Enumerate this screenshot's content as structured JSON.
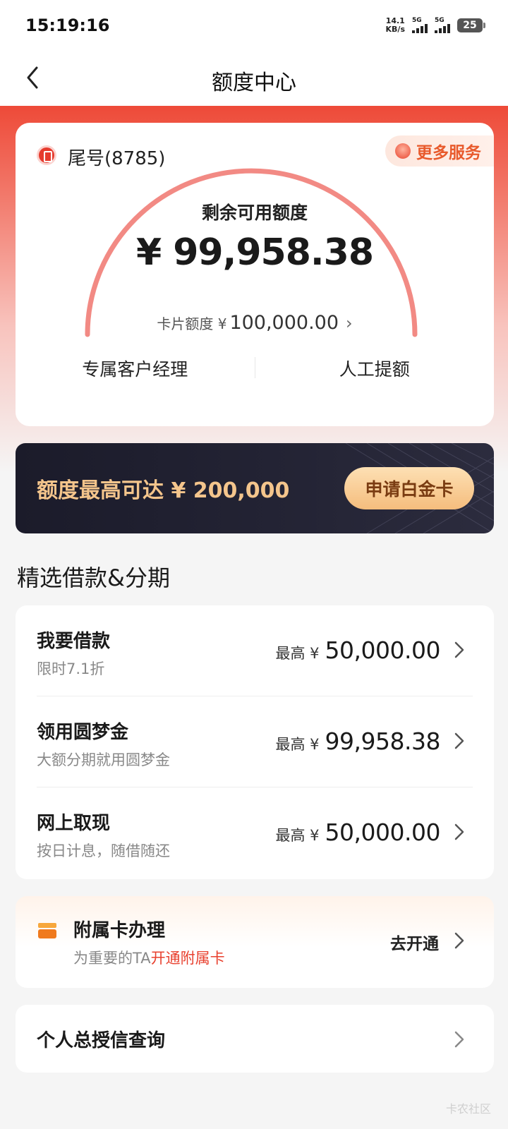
{
  "status_bar": {
    "time": "15:19:16",
    "net_speed_value": "14.1",
    "net_speed_unit": "KB/s",
    "signal1_label": "5G",
    "signal2_label": "5G",
    "battery": "25"
  },
  "nav": {
    "title": "额度中心",
    "back_icon": "chevron-left-icon"
  },
  "quota_card": {
    "card_tail": "尾号(8785)",
    "more_services": "更多服务",
    "remaining_label": "剩余可用额度",
    "remaining_amount": "¥ 99,958.38",
    "card_limit_label": "卡片额度 ¥",
    "card_limit_amount": "100,000.00",
    "actions": [
      "专属客户经理",
      "人工提额"
    ],
    "arc_color": "#f28a84"
  },
  "banner": {
    "text": "额度最高可达 ¥ 200,000",
    "button": "申请白金卡"
  },
  "section_title": "精选借款&分期",
  "loans": [
    {
      "name": "我要借款",
      "sub": "限时7.1折",
      "prefix": "最高 ¥",
      "amount": "50,000.00"
    },
    {
      "name": "领用圆梦金",
      "sub": "大额分期就用圆梦金",
      "prefix": "最高 ¥",
      "amount": "99,958.38"
    },
    {
      "name": "网上取现",
      "sub": "按日计息，随借随还",
      "prefix": "最高 ¥",
      "amount": "50,000.00"
    }
  ],
  "supplementary": {
    "title": "附属卡办理",
    "sub_prefix": "为重要的TA",
    "sub_highlight": "开通附属卡",
    "action": "去开通"
  },
  "credit_query": {
    "label": "个人总授信查询"
  },
  "watermark": "卡农社区",
  "colors": {
    "brand_red": "#ee4a38",
    "banner_gold": "#f4c58c",
    "highlight_red": "#e8402e"
  }
}
